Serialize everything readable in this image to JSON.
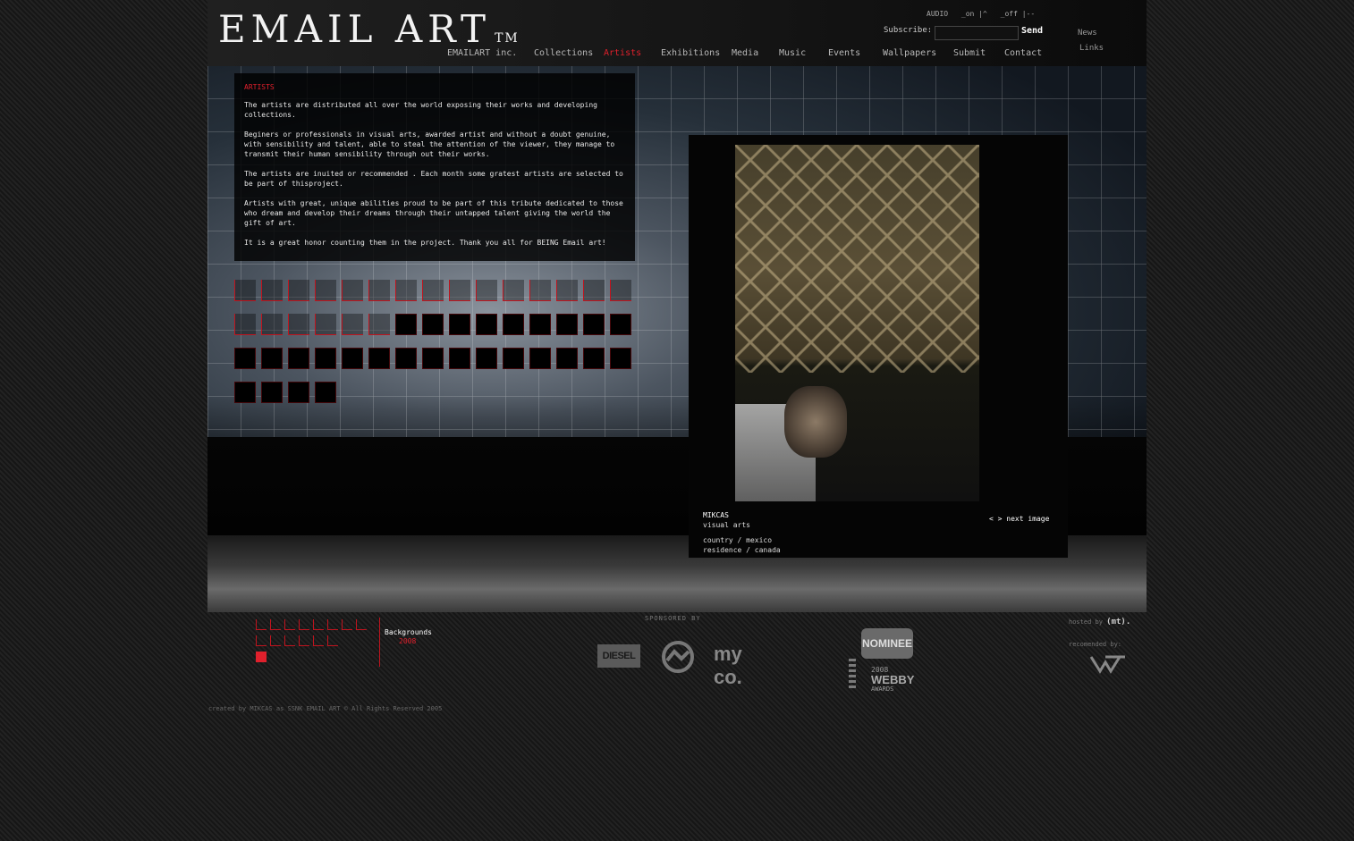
{
  "header": {
    "logo": "EMAIL ART",
    "logo_tm": "TM",
    "audio": {
      "label": "AUDIO",
      "on": "_on |^",
      "off": "_off |--"
    },
    "subscribe": {
      "label": "Subscribe:",
      "value": "",
      "send_label": "Send"
    },
    "side_links": [
      "News",
      "Links"
    ],
    "nav": [
      {
        "label": "EMAILART inc.",
        "active": false
      },
      {
        "label": "Collections",
        "active": false
      },
      {
        "label": "Artists",
        "active": true
      },
      {
        "label": "Exhibitions",
        "active": false
      },
      {
        "label": "Media",
        "active": false
      },
      {
        "label": "Music",
        "active": false
      },
      {
        "label": "Events",
        "active": false
      },
      {
        "label": "Wallpapers",
        "active": false
      },
      {
        "label": "Submit",
        "active": false
      },
      {
        "label": "Contact",
        "active": false
      }
    ]
  },
  "intro": {
    "title": "ARTISTS",
    "paragraphs": [
      "The artists are distributed all over the world exposing their works and developing collections.",
      "Beginers or professionals in visual arts, awarded artist and without a doubt genuine, with sensibility and talent, able to steal the attention of the viewer, they manage to transmit their human sensibility through out their works.",
      "The artists are inuited or recommended . Each month some gratest artists are selected  to be  part of thisproject.",
      "Artists with great, unique abilities proud to be part of this tribute dedicated to those who dream and develop their dreams through their untapped talent giving the world the gift of art.",
      "It is a great honor counting them in the project. Thank you all for BEING  Email art!"
    ]
  },
  "thumbnails": {
    "count": 49,
    "outlined_count": 21
  },
  "viewer": {
    "artist_name": "MIKCAS",
    "discipline": "visual arts",
    "country": "country / mexico",
    "residence": "residence / canada",
    "next_label": "< > next image"
  },
  "footer": {
    "backgrounds_label": "Backgrounds",
    "backgrounds_year": "2008",
    "background_cells": 14,
    "sponsored_label": "SPONSORED BY",
    "sponsors": [
      "DIESEL",
      "my co."
    ],
    "webby": {
      "nominee": "NOMINEE",
      "year": "2008",
      "name": "WEBBY",
      "awards": "AWARDS"
    },
    "hosted_label": "hosted by",
    "hosted_name": "(mt).",
    "recommended_label": "recomended by:",
    "credits": "created by MIKCAS as SSNK  EMAIL ART © All Rights Reserved 2005"
  },
  "colors": {
    "accent": "#e0202c",
    "background": "#1a1a1a"
  }
}
